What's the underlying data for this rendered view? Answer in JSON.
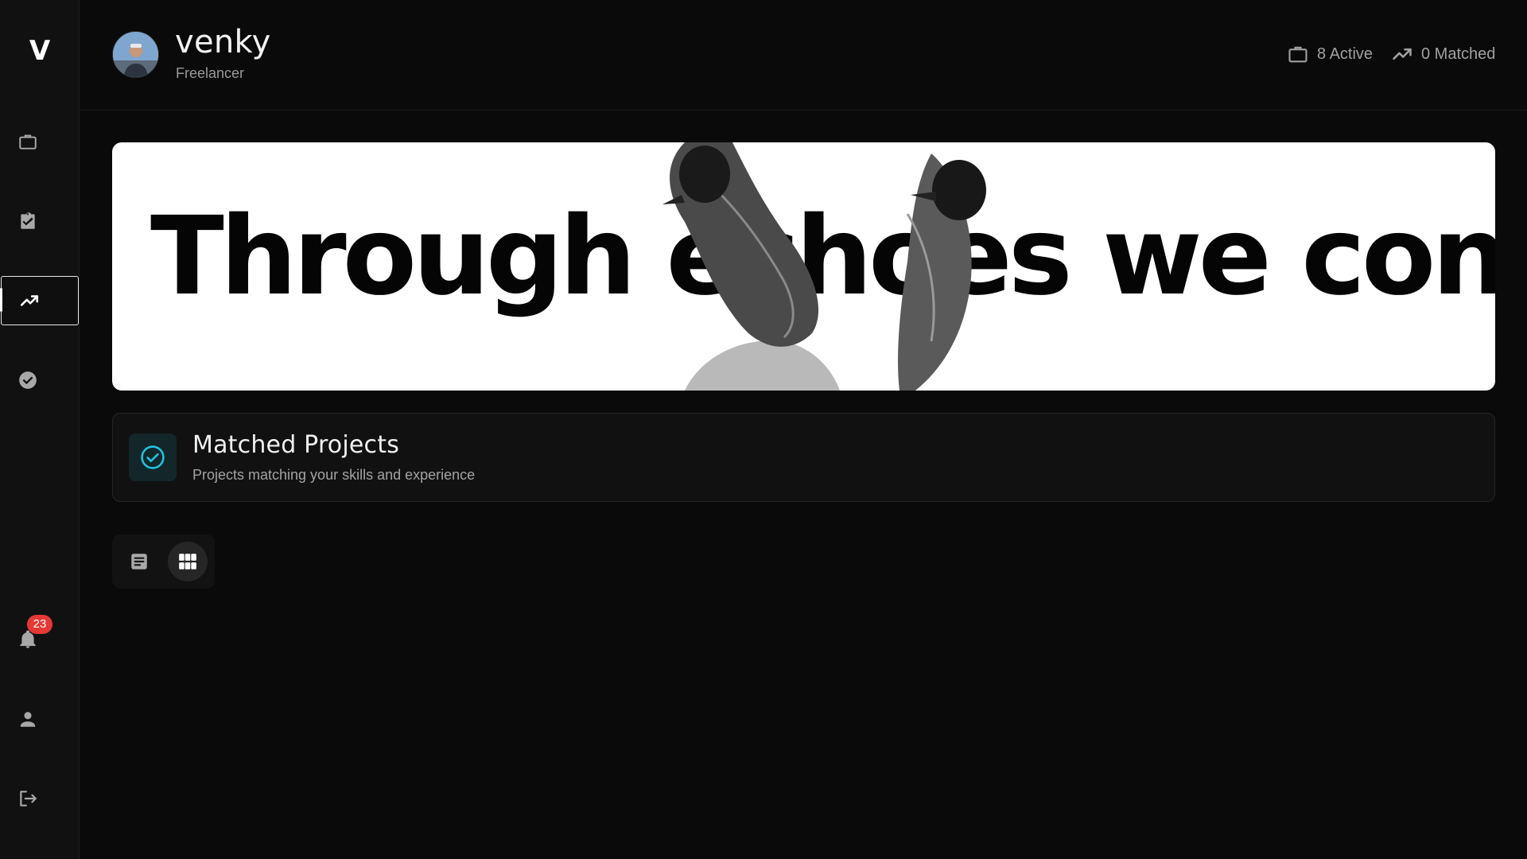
{
  "sidebar": {
    "logo": "V",
    "items": [
      {
        "name": "nav-projects",
        "icon": "briefcase-icon"
      },
      {
        "name": "nav-tasks",
        "icon": "clipboard-check-icon"
      },
      {
        "name": "nav-trending",
        "icon": "trending-up-icon",
        "active": true
      },
      {
        "name": "nav-completed",
        "icon": "check-circle-icon"
      }
    ],
    "bottom": [
      {
        "name": "nav-notifications",
        "icon": "bell-icon",
        "badge": "23"
      },
      {
        "name": "nav-profile",
        "icon": "user-icon"
      },
      {
        "name": "nav-logout",
        "icon": "logout-icon"
      }
    ]
  },
  "header": {
    "user_name": "venky",
    "user_role": "Freelancer",
    "stats": {
      "active": "8 Active",
      "matched": "0 Matched"
    }
  },
  "hero": {
    "text": "Through echoes we connect."
  },
  "matched_section": {
    "title": "Matched Projects",
    "subtitle": "Projects matching your skills and experience"
  },
  "view_toggle": {
    "options": [
      "list-view",
      "grid-view"
    ],
    "selected": "grid-view"
  },
  "colors": {
    "background": "#0a0a0a",
    "sidebar": "#111111",
    "accent_teal": "#22c3dd",
    "badge_red": "#e53935"
  }
}
